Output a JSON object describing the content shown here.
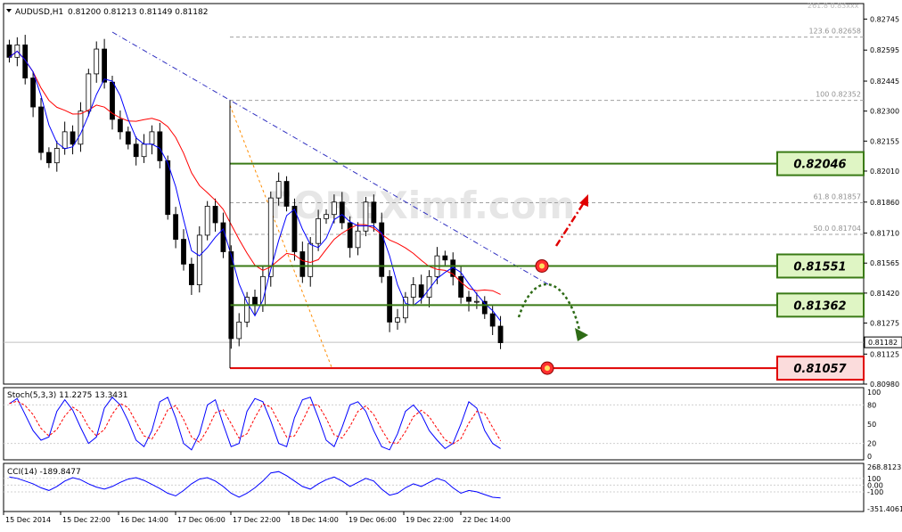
{
  "header": {
    "symbol": "AUDUSD,H1",
    "ohlc": "0.81200 0.81213 0.81149 0.81182"
  },
  "price_axis": {
    "ticks": [
      "0.82745",
      "0.82595",
      "0.82445",
      "0.82300",
      "0.82155",
      "0.82010",
      "0.81860",
      "0.81710",
      "0.81565",
      "0.81420",
      "0.81275",
      "0.81125",
      "0.80980"
    ],
    "current": "0.81182",
    "top_partial": "261.8 0.83xxx"
  },
  "fib_levels": [
    {
      "label": "123.6  0.82658"
    },
    {
      "label": "100  0.82352"
    },
    {
      "label": "61.8  0.81857"
    },
    {
      "label": "50.0  0.81704"
    }
  ],
  "levels": [
    {
      "label": "0.82046",
      "kind": "resistance",
      "color": "#3a7a16"
    },
    {
      "label": "0.81551",
      "kind": "resistance",
      "color": "#3a7a16"
    },
    {
      "label": "0.81362",
      "kind": "support",
      "color": "#3a7a16"
    },
    {
      "label": "0.81057",
      "kind": "support",
      "color": "#e00000"
    }
  ],
  "watermark": "FOREXimf.com",
  "stoch": {
    "label": "Stoch(5,3,3) 11.2275 13.3431",
    "ticks": [
      "100",
      "80",
      "50",
      "20",
      "0"
    ]
  },
  "cci": {
    "label": "CCI(14) -189.8477",
    "ticks": [
      "268.8123",
      "100",
      "0.00",
      "-100",
      "-351.4061"
    ]
  },
  "time_axis": [
    "15 Dec 2014",
    "15 Dec 22:00",
    "16 Dec 14:00",
    "17 Dec 06:00",
    "17 Dec 22:00",
    "18 Dec 14:00",
    "19 Dec 06:00",
    "19 Dec 22:00",
    "22 Dec 14:00"
  ],
  "colors": {
    "bull": "#ffffff",
    "bear": "#000000",
    "ma_fast": "#0000ff",
    "ma_slow": "#ff0000",
    "stoch_main": "#0000ff",
    "stoch_signal": "#ff0000",
    "cci": "#0000ff",
    "trendline": "#3030c0",
    "fib": "#ff8c00",
    "arrow_up": "#e00000",
    "arrow_down": "#2e6b16"
  },
  "chart_data": {
    "type": "candlestick",
    "instrument": "AUDUSD",
    "timeframe": "H1",
    "ylim": [
      0.8098,
      0.8282
    ],
    "horizontal_levels": [
      0.82046,
      0.81551,
      0.81362,
      0.81057
    ],
    "fibonacci": [
      {
        "ratio": "123.6",
        "price": 0.82658
      },
      {
        "ratio": "100",
        "price": 0.82352
      },
      {
        "ratio": "61.8",
        "price": 0.81857
      },
      {
        "ratio": "50.0",
        "price": 0.81704
      }
    ],
    "close_path": [
      0.8256,
      0.8262,
      0.8246,
      0.8232,
      0.821,
      0.8205,
      0.8212,
      0.822,
      0.8214,
      0.823,
      0.8248,
      0.826,
      0.8244,
      0.8226,
      0.822,
      0.8214,
      0.8208,
      0.8214,
      0.822,
      0.8206,
      0.818,
      0.8168,
      0.8156,
      0.8146,
      0.817,
      0.8184,
      0.8176,
      0.8162,
      0.812,
      0.8128,
      0.814,
      0.8136,
      0.815,
      0.8188,
      0.8196,
      0.8184,
      0.8162,
      0.815,
      0.8166,
      0.8178,
      0.818,
      0.8186,
      0.8176,
      0.8164,
      0.8172,
      0.8186,
      0.8176,
      0.815,
      0.8128,
      0.813,
      0.814,
      0.8146,
      0.814,
      0.815,
      0.816,
      0.8158,
      0.815,
      0.814,
      0.8138,
      0.8138,
      0.8132,
      0.8126,
      0.8118
    ],
    "stoch_main": [
      82,
      90,
      65,
      40,
      25,
      30,
      70,
      88,
      72,
      45,
      20,
      30,
      75,
      92,
      80,
      55,
      25,
      15,
      40,
      85,
      92,
      60,
      20,
      10,
      35,
      80,
      88,
      50,
      15,
      20,
      70,
      90,
      85,
      55,
      20,
      15,
      60,
      88,
      92,
      60,
      25,
      15,
      45,
      80,
      85,
      70,
      40,
      15,
      10,
      35,
      70,
      80,
      65,
      40,
      25,
      12,
      20,
      50,
      85,
      75,
      40,
      20,
      12
    ],
    "cci": [
      120,
      100,
      60,
      20,
      -40,
      -80,
      -20,
      60,
      110,
      80,
      20,
      -30,
      -60,
      -20,
      40,
      90,
      110,
      70,
      10,
      -50,
      -120,
      -160,
      -80,
      20,
      90,
      110,
      60,
      -20,
      -120,
      -180,
      -120,
      -40,
      60,
      180,
      200,
      140,
      60,
      -20,
      -60,
      20,
      80,
      120,
      60,
      -20,
      40,
      100,
      60,
      -60,
      -150,
      -120,
      -40,
      20,
      -20,
      40,
      100,
      60,
      -40,
      -120,
      -80,
      -100,
      -140,
      -180,
      -190
    ]
  }
}
